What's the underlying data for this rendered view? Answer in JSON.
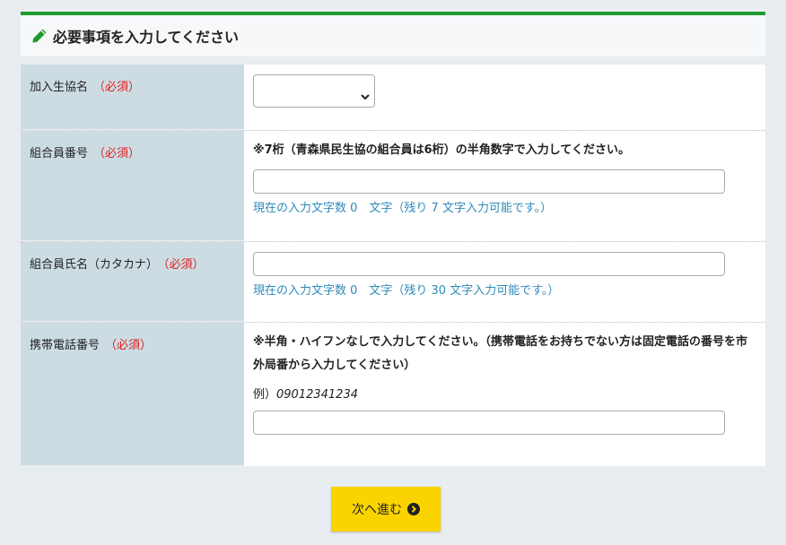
{
  "header": {
    "title": "必要事項を入力してください"
  },
  "required_label": "（必須）",
  "fields": {
    "coop": {
      "label": "加入生協名"
    },
    "member_no": {
      "label": "組合員番号",
      "note": "※7桁（青森県民生協の組合員は6桁）の半角数字で入力してください。",
      "counter": "現在の入力文字数 0　文字（残り 7 文字入力可能です。）"
    },
    "member_name": {
      "label": "組合員氏名（カタカナ）",
      "counter": "現在の入力文字数 0　文字（残り 30 文字入力可能です。）"
    },
    "mobile": {
      "label": "携帯電話番号",
      "note": "※半角・ハイフンなしで入力してください。（携帯電話をお持ちでない方は固定電話の番号を市外局番から入力してください）",
      "example_prefix": "例）",
      "example_value": "09012341234"
    }
  },
  "next_button": {
    "label": "次へ進む"
  },
  "colors": {
    "accent": "#1e9b2e",
    "label_bg": "#cddce3",
    "required": "#e02020",
    "counter": "#2d8ab8",
    "button": "#fbd400"
  }
}
